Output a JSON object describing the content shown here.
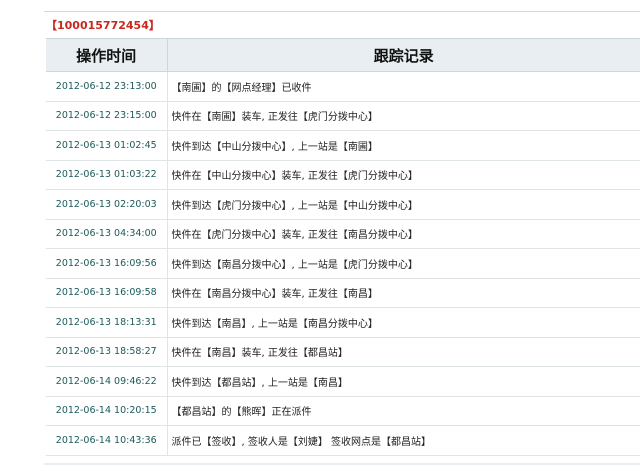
{
  "tracking_number": "【100015772454】",
  "table": {
    "headers": {
      "time": "操作时间",
      "record": "跟踪记录"
    },
    "rows": [
      {
        "time": "2012-06-12 23:13:00",
        "record": "【南圃】的【网点经理】已收件"
      },
      {
        "time": "2012-06-12 23:15:00",
        "record": "快件在【南圃】装车, 正发往【虎门分拨中心】"
      },
      {
        "time": "2012-06-13 01:02:45",
        "record": "快件到达【中山分拨中心】, 上一站是【南圃】"
      },
      {
        "time": "2012-06-13 01:03:22",
        "record": "快件在【中山分拨中心】装车, 正发往【虎门分拨中心】"
      },
      {
        "time": "2012-06-13 02:20:03",
        "record": "快件到达【虎门分拨中心】, 上一站是【中山分拨中心】"
      },
      {
        "time": "2012-06-13 04:34:00",
        "record": "快件在【虎门分拨中心】装车, 正发往【南昌分拨中心】"
      },
      {
        "time": "2012-06-13 16:09:56",
        "record": "快件到达【南昌分拨中心】, 上一站是【虎门分拨中心】"
      },
      {
        "time": "2012-06-13 16:09:58",
        "record": "快件在【南昌分拨中心】装车, 正发往【南昌】"
      },
      {
        "time": "2012-06-13 18:13:31",
        "record": "快件到达【南昌】, 上一站是【南昌分拨中心】"
      },
      {
        "time": "2012-06-13 18:58:27",
        "record": "快件在【南昌】装车, 正发往【都昌站】"
      },
      {
        "time": "2012-06-14 09:46:22",
        "record": "快件到达【都昌站】, 上一站是【南昌】"
      },
      {
        "time": "2012-06-14 10:20:15",
        "record": "【都昌站】的【熊晖】正在派件"
      },
      {
        "time": "2012-06-14 10:43:36",
        "record": "派件已【签收】, 签收人是【刘婕】 签收网点是【都昌站】"
      }
    ]
  }
}
